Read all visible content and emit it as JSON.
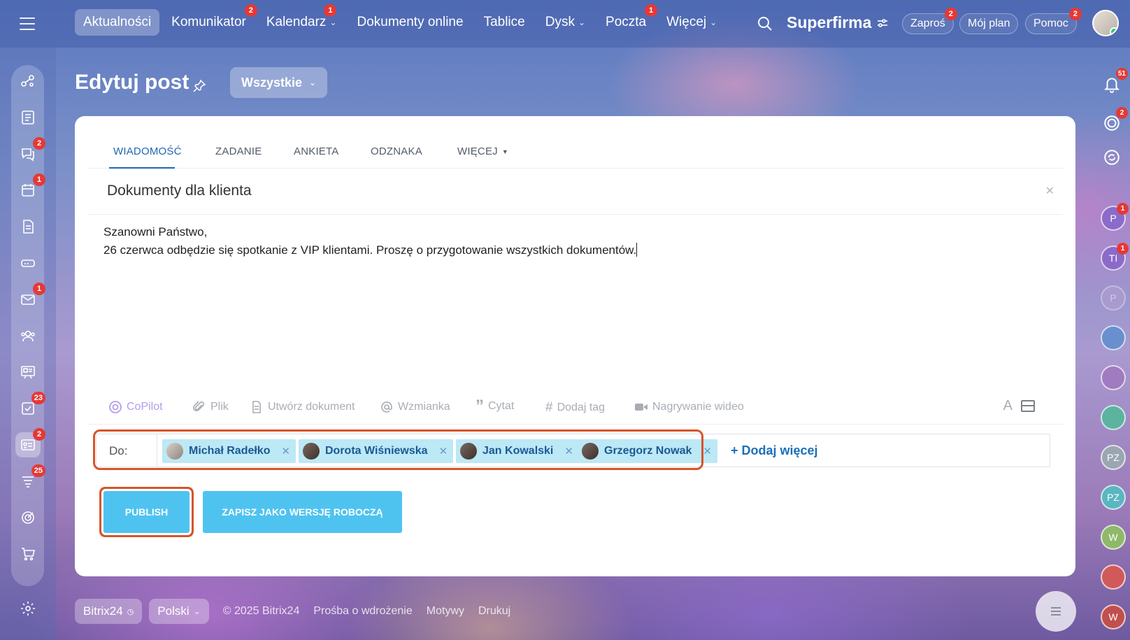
{
  "topbar": {
    "nav": [
      {
        "label": "Aktualności",
        "active": true,
        "badge": ""
      },
      {
        "label": "Komunikator",
        "badge": "2"
      },
      {
        "label": "Kalendarz",
        "badge": "1",
        "dropdown": true
      },
      {
        "label": "Dokumenty online",
        "badge": ""
      },
      {
        "label": "Tablice",
        "badge": ""
      },
      {
        "label": "Dysk",
        "badge": "",
        "dropdown": true
      },
      {
        "label": "Poczta",
        "badge": "1"
      },
      {
        "label": "Więcej",
        "badge": "",
        "dropdown": true
      }
    ],
    "brand": "Superfirma",
    "invite_label": "Zaproś",
    "invite_badge": "2",
    "plan_label": "Mój plan",
    "help_label": "Pomoc",
    "help_badge": "2"
  },
  "sidebar": {
    "badges": {
      "chat": "2",
      "calendar": "1",
      "mail": "1",
      "tasks": "23",
      "feed": "2",
      "crm": "25"
    }
  },
  "rightbar": {
    "notifications_badge": "51",
    "activity_badge": "2",
    "avatars": [
      {
        "initials": "P",
        "badge": "1",
        "color": "#8a6bc9"
      },
      {
        "initials": "TI",
        "badge": "1",
        "color": "#8a6bc9"
      },
      {
        "initials": "P",
        "badge": "",
        "color": "#b49fd0"
      },
      {
        "initials": "",
        "badge": "",
        "color": "#6a8fcf"
      },
      {
        "initials": "",
        "badge": "",
        "color": "#a07bbf"
      },
      {
        "initials": "",
        "badge": "",
        "color": "#5bb3a0"
      },
      {
        "initials": "PZ",
        "badge": "",
        "color": "#9aa6b2"
      },
      {
        "initials": "PZ",
        "badge": "",
        "color": "#5ab6c2"
      },
      {
        "initials": "W",
        "badge": "",
        "color": "#8fb86a"
      },
      {
        "initials": "",
        "badge": "",
        "color": "#d05a5a"
      },
      {
        "initials": "W",
        "badge": "",
        "color": "#c0504d"
      }
    ]
  },
  "page": {
    "title": "Edytuj post",
    "filter_label": "Wszystkie"
  },
  "tabs": {
    "message": "WIADOMOŚĆ",
    "task": "ZADANIE",
    "poll": "ANKIETA",
    "badge": "ODZNAKA",
    "more": "WIĘCEJ"
  },
  "post": {
    "title": "Dokumenty dla klienta",
    "line1": "Szanowni Państwo,",
    "line2": "26 czerwca odbędzie się spotkanie z VIP klientami. Proszę o przygotowanie wszystkich dokumentów."
  },
  "toolbar": {
    "copilot": "CoPilot",
    "file": "Plik",
    "create_doc": "Utwórz dokument",
    "mention": "Wzmianka",
    "quote": "Cytat",
    "tag": "Dodaj tag",
    "video": "Nagrywanie wideo",
    "format": "A"
  },
  "recipients": {
    "label": "Do:",
    "people": [
      "Michał Radełko",
      "Dorota Wiśniewska",
      "Jan Kowalski",
      "Grzegorz Nowak"
    ],
    "add_more": "+ Dodaj więcej"
  },
  "actions": {
    "publish": "PUBLISH",
    "draft": "ZAPISZ JAKO WERSJĘ ROBOCZĄ"
  },
  "footer": {
    "brand": "Bitrix24",
    "language": "Polski",
    "copyright": "© 2025 Bitrix24",
    "link_implementation": "Prośba o wdrożenie",
    "link_themes": "Motywy",
    "link_print": "Drukuj"
  }
}
